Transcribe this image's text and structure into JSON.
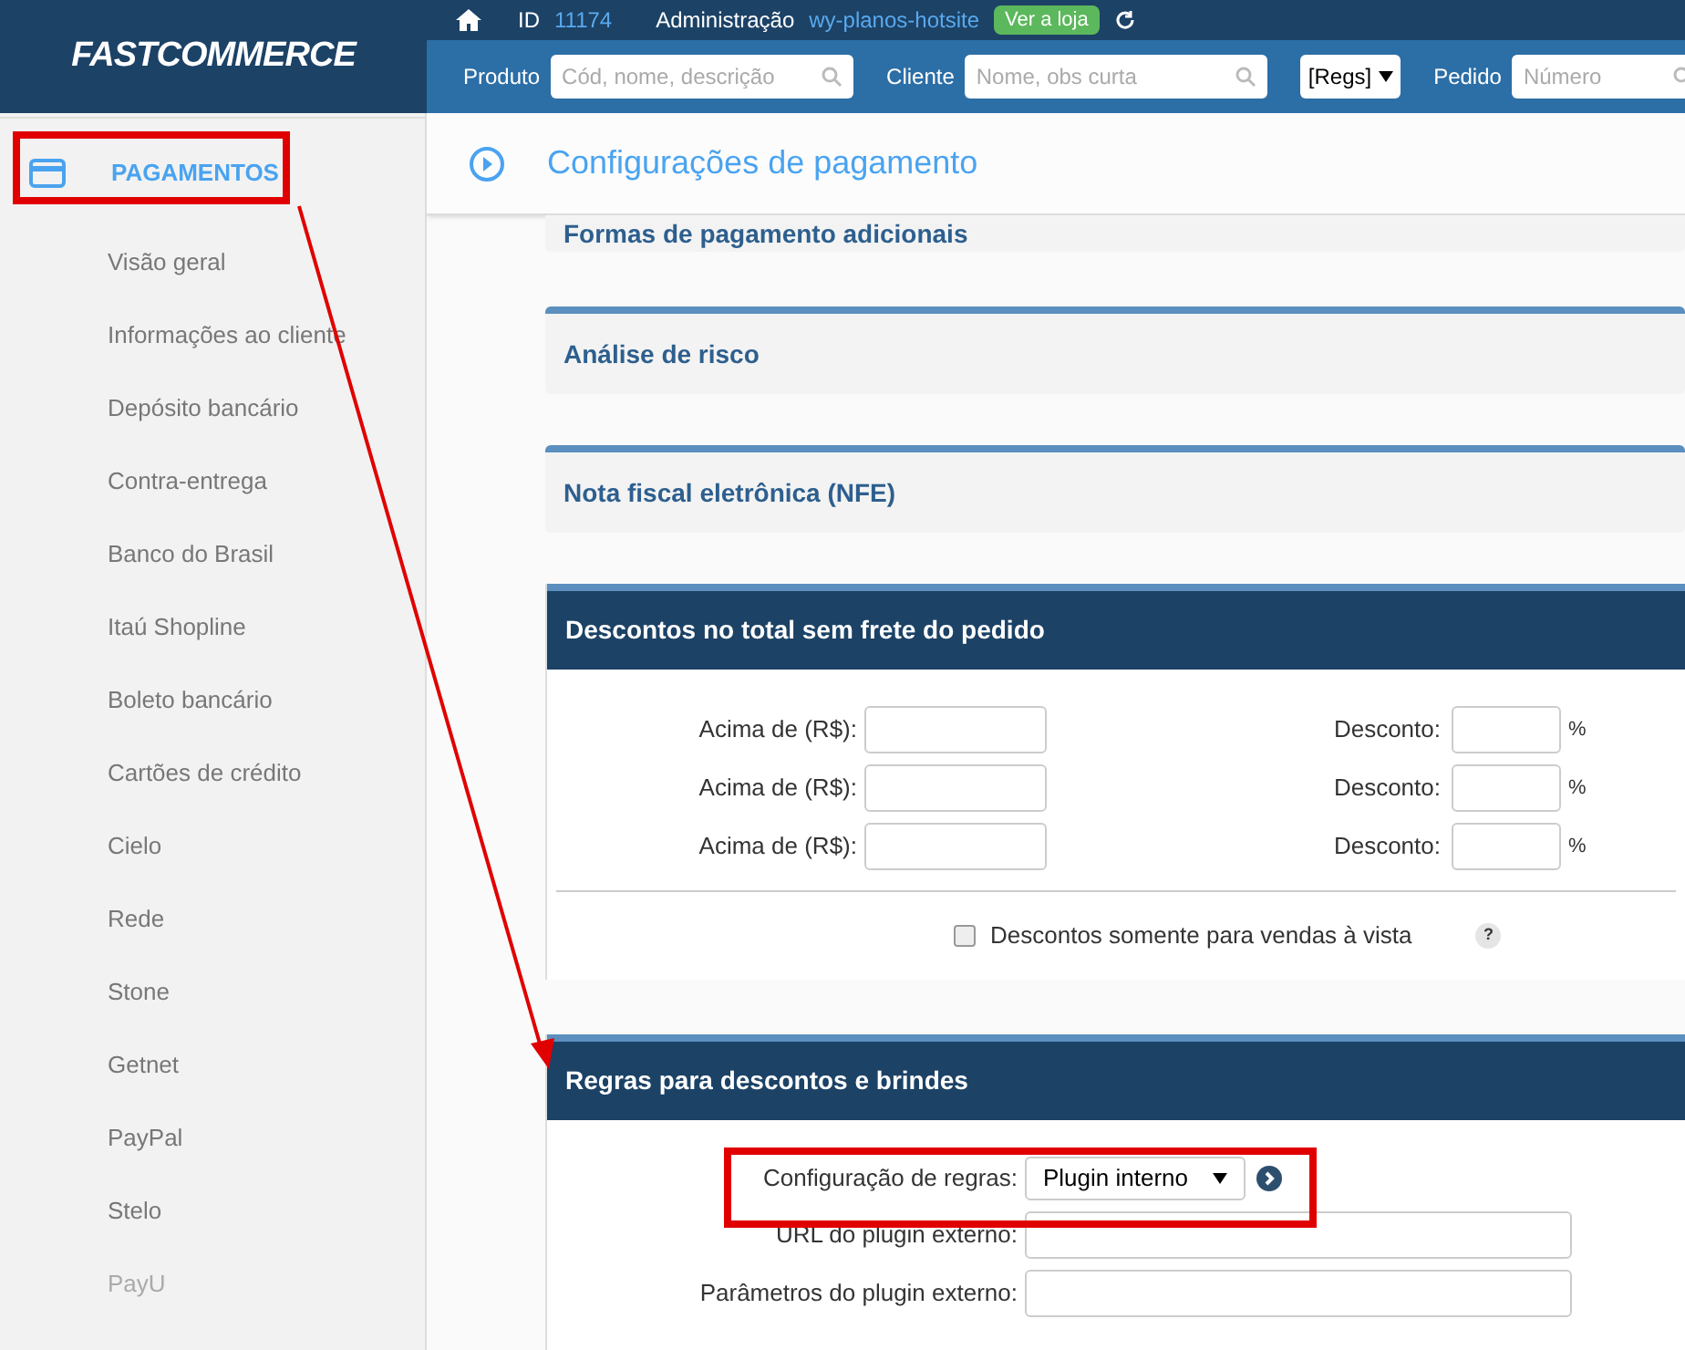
{
  "header": {
    "logo": "FASTCOMMERCE",
    "id_label": "ID",
    "id_value": "11174",
    "admin_label": "Administração",
    "store_link": "wy-planos-hotsite",
    "store_button": "Ver a loja",
    "search": [
      {
        "kind": "field",
        "label": "Produto",
        "placeholder": "Cód, nome, descrição"
      },
      {
        "kind": "field",
        "label": "Cliente",
        "placeholder": "Nome, obs curta"
      },
      {
        "kind": "select",
        "value": "[Regs]"
      },
      {
        "kind": "field",
        "label": "Pedido",
        "placeholder": "Número"
      }
    ]
  },
  "sidebar": {
    "section": "PAGAMENTOS",
    "items": [
      {
        "label": "Visão geral",
        "disabled": false
      },
      {
        "label": "Informações ao cliente",
        "disabled": false
      },
      {
        "label": "Depósito bancário",
        "disabled": false
      },
      {
        "label": "Contra-entrega",
        "disabled": false
      },
      {
        "label": "Banco do Brasil",
        "disabled": false
      },
      {
        "label": "Itaú Shopline",
        "disabled": false
      },
      {
        "label": "Boleto bancário",
        "disabled": false
      },
      {
        "label": "Cartões de crédito",
        "disabled": false
      },
      {
        "label": "Cielo",
        "disabled": false
      },
      {
        "label": "Rede",
        "disabled": false
      },
      {
        "label": "Stone",
        "disabled": false
      },
      {
        "label": "Getnet",
        "disabled": false
      },
      {
        "label": "PayPal",
        "disabled": false
      },
      {
        "label": "Stelo",
        "disabled": false
      },
      {
        "label": "PayU",
        "disabled": true
      }
    ]
  },
  "page_title": "Configurações de pagamento",
  "collapsed_panels": [
    "Formas de pagamento adicionais",
    "Análise de risco",
    "Nota fiscal eletrônica (NFE)"
  ],
  "discounts": {
    "title": "Descontos no total sem frete do pedido",
    "rows": [
      {
        "above_label": "Acima de (R$):",
        "discount_label": "Desconto:",
        "unit": "%"
      },
      {
        "above_label": "Acima de (R$):",
        "discount_label": "Desconto:",
        "unit": "%"
      },
      {
        "above_label": "Acima de (R$):",
        "discount_label": "Desconto:",
        "unit": "%"
      }
    ],
    "cash_only": {
      "label": "Descontos somente para vendas à vista",
      "checked": false,
      "help": "?"
    }
  },
  "rules": {
    "title": "Regras para descontos e brindes",
    "config_label": "Configuração de regras:",
    "config_value": "Plugin interno",
    "url_label": "URL do plugin externo:",
    "params_label": "Parâmetros do plugin externo:"
  }
}
